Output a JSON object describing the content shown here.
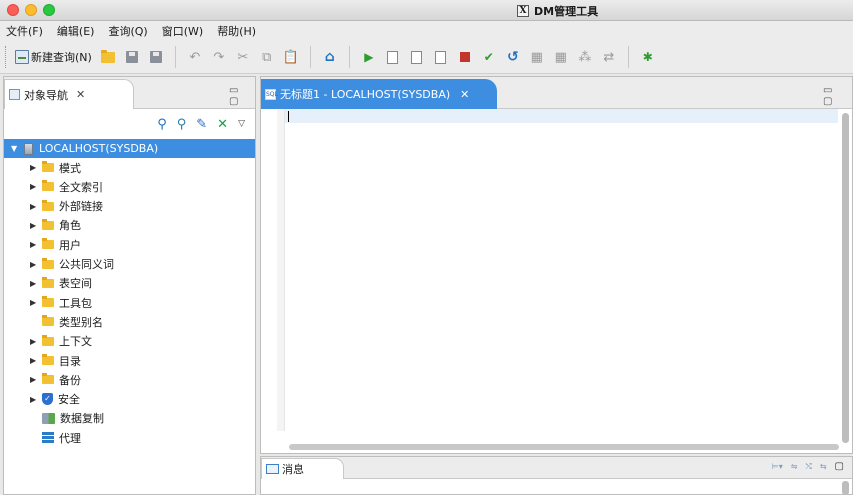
{
  "window": {
    "title": "DM管理工具",
    "logo": "X"
  },
  "menu": [
    "文件(F)",
    "编辑(E)",
    "查询(Q)",
    "窗口(W)",
    "帮助(H)"
  ],
  "toolbar": {
    "new_query_label": "新建查询(N)"
  },
  "navigator": {
    "tab_label": "对象导航",
    "close": "✕",
    "pane_controls": "▭ ▢",
    "root": "LOCALHOST(SYSDBA)",
    "items": [
      {
        "label": "模式",
        "expandable": true,
        "icon": "folder-icon"
      },
      {
        "label": "全文索引",
        "expandable": true,
        "icon": "folder-icon"
      },
      {
        "label": "外部链接",
        "expandable": true,
        "icon": "folder-icon"
      },
      {
        "label": "角色",
        "expandable": true,
        "icon": "folder-icon"
      },
      {
        "label": "用户",
        "expandable": true,
        "icon": "folder-icon"
      },
      {
        "label": "公共同义词",
        "expandable": true,
        "icon": "folder-icon"
      },
      {
        "label": "表空间",
        "expandable": true,
        "icon": "folder-icon"
      },
      {
        "label": "工具包",
        "expandable": true,
        "icon": "folder-icon"
      },
      {
        "label": "类型别名",
        "expandable": false,
        "icon": "folder-icon"
      },
      {
        "label": "上下文",
        "expandable": true,
        "icon": "folder-icon"
      },
      {
        "label": "目录",
        "expandable": true,
        "icon": "folder-icon"
      },
      {
        "label": "备份",
        "expandable": true,
        "icon": "folder-icon"
      },
      {
        "label": "安全",
        "expandable": true,
        "icon": "shield-icon"
      },
      {
        "label": "数据复制",
        "expandable": false,
        "icon": "replication-icon"
      },
      {
        "label": "代理",
        "expandable": false,
        "icon": "agent-icon"
      }
    ]
  },
  "editor": {
    "tab_label": "无标题1 - LOCALHOST(SYSDBA)",
    "close": "✕",
    "pane_controls": "▭ ▢"
  },
  "messages": {
    "tab_label": "消息",
    "maximize": "▢"
  },
  "colors": {
    "selection": "#3d8ee0",
    "folder": "#f3c033"
  }
}
